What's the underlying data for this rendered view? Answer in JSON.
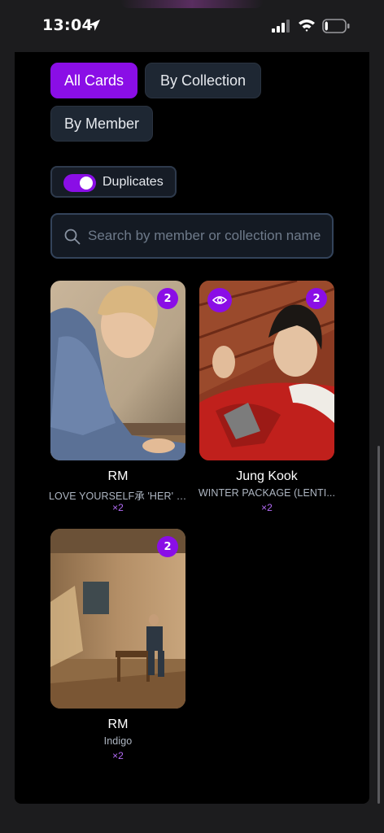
{
  "status_bar": {
    "time": "13:04",
    "location_icon": "location-arrow-icon",
    "signal_icon": "cellular-signal-icon",
    "wifi_icon": "wifi-icon",
    "battery_icon": "battery-icon",
    "battery_level": 0.15
  },
  "filters": {
    "tabs": [
      {
        "label": "All Cards",
        "active": true
      },
      {
        "label": "By Collection",
        "active": false
      },
      {
        "label": "By Member",
        "active": false
      }
    ],
    "duplicates_label": "Duplicates",
    "duplicates_on": true
  },
  "search": {
    "placeholder": "Search by member or collection name",
    "value": ""
  },
  "cards": [
    {
      "member": "RM",
      "collection": "LOVE YOURSELF承 'HER' - L",
      "multiplier": "×2",
      "count": "2",
      "has_eye": false
    },
    {
      "member": "Jung Kook",
      "collection": "WINTER PACKAGE (LENTI...",
      "multiplier": "×2",
      "count": "2",
      "has_eye": true
    },
    {
      "member": "RM",
      "collection": "Indigo",
      "multiplier": "×2",
      "count": "2",
      "has_eye": false
    }
  ],
  "colors": {
    "accent": "#8a0ee6",
    "multiplier": "#b46cf7",
    "background": "#000000"
  }
}
